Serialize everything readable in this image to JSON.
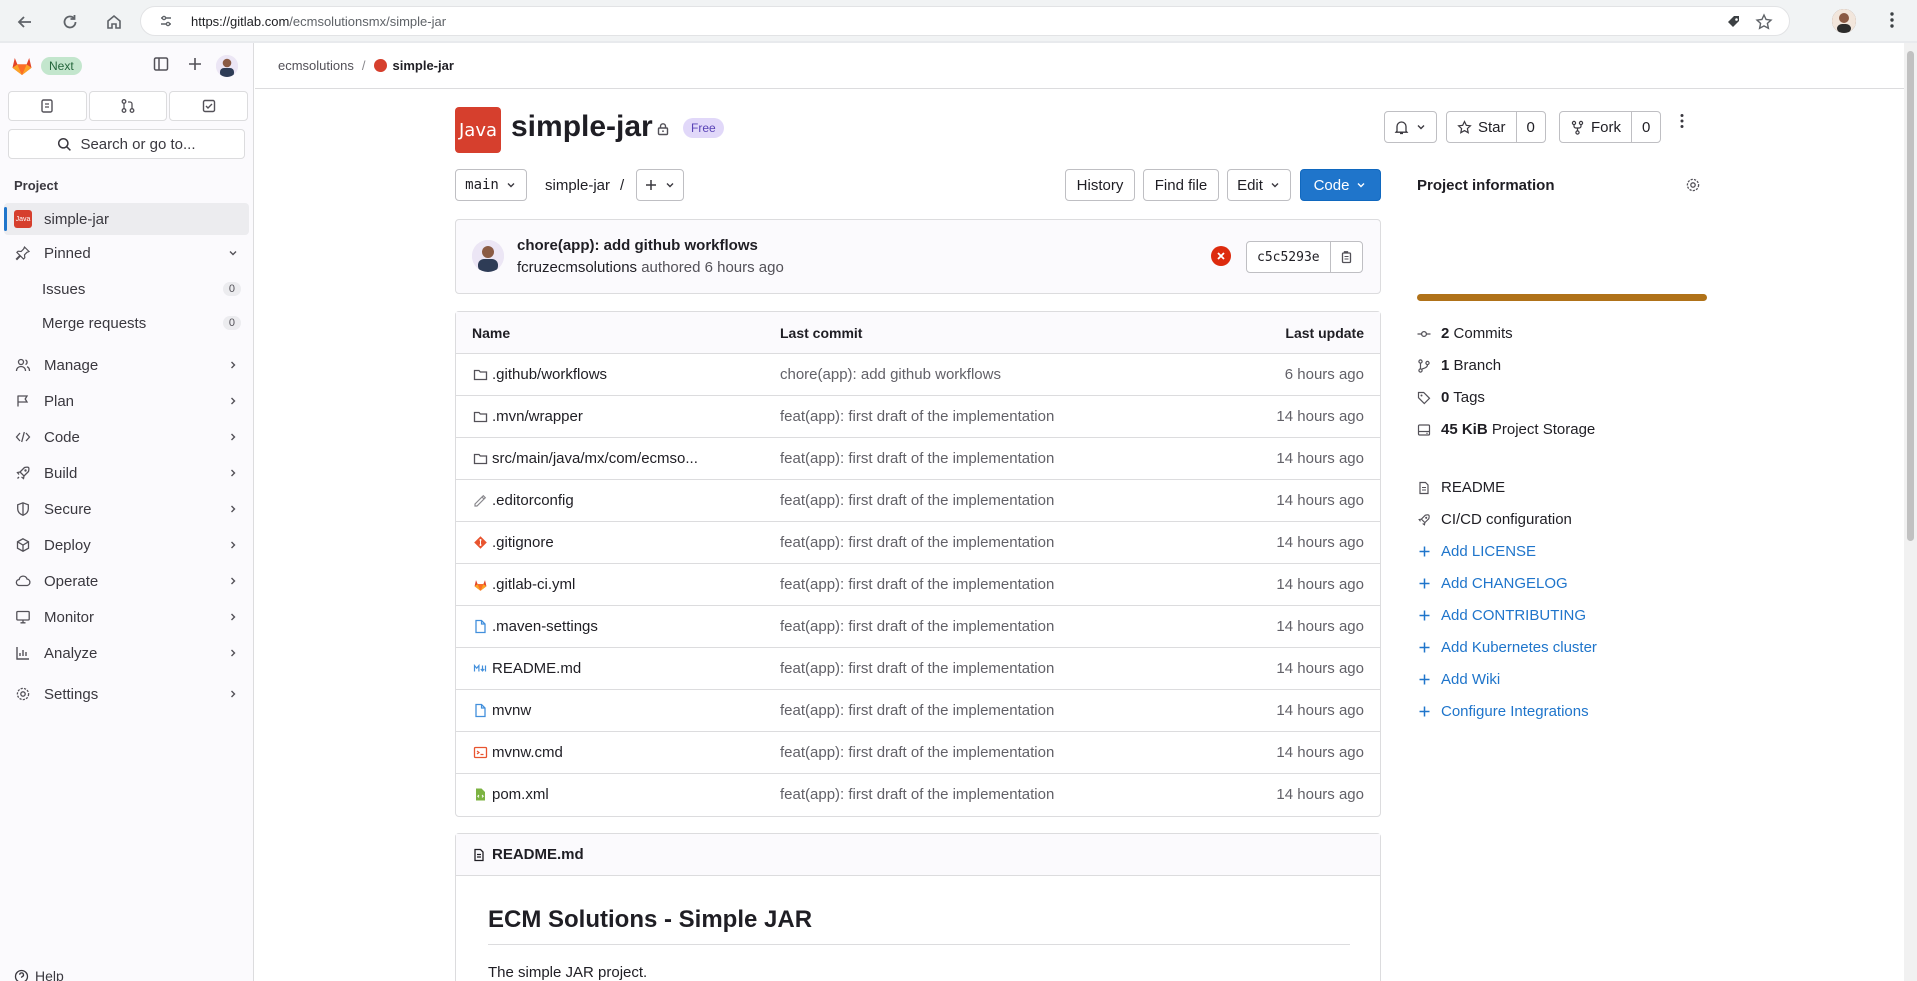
{
  "browser": {
    "url_host": "https://gitlab.com",
    "url_path": "/ecmsolutionsmx/simple-jar"
  },
  "sidebar": {
    "next_badge": "Next",
    "search_label": "Search or go to...",
    "section_label": "Project",
    "project_name": "simple-jar",
    "project_avatar_text": "Java",
    "pinned_label": "Pinned",
    "pinned_items": [
      {
        "label": "Issues",
        "count": "0"
      },
      {
        "label": "Merge requests",
        "count": "0"
      }
    ],
    "nav_items": [
      {
        "label": "Manage",
        "icon": "users-icon"
      },
      {
        "label": "Plan",
        "icon": "planning-icon"
      },
      {
        "label": "Code",
        "icon": "code-icon"
      },
      {
        "label": "Build",
        "icon": "rocket-icon"
      },
      {
        "label": "Secure",
        "icon": "shield-icon"
      },
      {
        "label": "Deploy",
        "icon": "deploy-icon"
      },
      {
        "label": "Operate",
        "icon": "cloud-icon"
      },
      {
        "label": "Monitor",
        "icon": "monitor-icon"
      },
      {
        "label": "Analyze",
        "icon": "chart-icon"
      },
      {
        "label": "Settings",
        "icon": "settings-icon"
      }
    ],
    "help_label": "Help"
  },
  "breadcrumb": {
    "group": "ecmsolutions",
    "project": "simple-jar"
  },
  "project": {
    "avatar_text": "Java",
    "title": "simple-jar",
    "tier_badge": "Free",
    "star_label": "Star",
    "star_count": "0",
    "fork_label": "Fork",
    "fork_count": "0"
  },
  "repo_toolbar": {
    "branch": "main",
    "path_root": "simple-jar",
    "path_sep": "/",
    "history_label": "History",
    "find_file_label": "Find file",
    "edit_label": "Edit",
    "code_label": "Code"
  },
  "last_commit": {
    "title": "chore(app): add github workflows",
    "author": "fcruzecmsolutions",
    "meta": "authored 6 hours ago",
    "sha": "c5c5293e"
  },
  "file_table": {
    "headers": {
      "name": "Name",
      "last_commit": "Last commit",
      "last_update": "Last update"
    },
    "rows": [
      {
        "name": ".github/workflows",
        "type": "folder",
        "commit": "chore(app): add github workflows",
        "updated": "6 hours ago"
      },
      {
        "name": ".mvn/wrapper",
        "type": "folder",
        "commit": "feat(app): first draft of the implementation",
        "updated": "14 hours ago"
      },
      {
        "name": "src/main/java/mx/com/ecmso...",
        "type": "folder",
        "commit": "feat(app): first draft of the implementation",
        "updated": "14 hours ago"
      },
      {
        "name": ".editorconfig",
        "type": "editorconfig",
        "commit": "feat(app): first draft of the implementation",
        "updated": "14 hours ago"
      },
      {
        "name": ".gitignore",
        "type": "git",
        "commit": "feat(app): first draft of the implementation",
        "updated": "14 hours ago"
      },
      {
        "name": ".gitlab-ci.yml",
        "type": "gitlab",
        "commit": "feat(app): first draft of the implementation",
        "updated": "14 hours ago"
      },
      {
        "name": ".maven-settings",
        "type": "file",
        "commit": "feat(app): first draft of the implementation",
        "updated": "14 hours ago"
      },
      {
        "name": "README.md",
        "type": "markdown",
        "commit": "feat(app): first draft of the implementation",
        "updated": "14 hours ago"
      },
      {
        "name": "mvnw",
        "type": "file",
        "commit": "feat(app): first draft of the implementation",
        "updated": "14 hours ago"
      },
      {
        "name": "mvnw.cmd",
        "type": "cmd",
        "commit": "feat(app): first draft of the implementation",
        "updated": "14 hours ago"
      },
      {
        "name": "pom.xml",
        "type": "xml",
        "commit": "feat(app): first draft of the implementation",
        "updated": "14 hours ago"
      }
    ]
  },
  "readme": {
    "filename": "README.md",
    "heading": "ECM Solutions - Simple JAR",
    "paragraph": "The simple JAR project."
  },
  "project_info": {
    "title": "Project information",
    "language_bar_color": "#b07219",
    "language_bar_fraction": 1.0,
    "stats": [
      {
        "value": "2",
        "label": "Commits",
        "icon": "commit-icon"
      },
      {
        "value": "1",
        "label": "Branch",
        "icon": "branch-icon"
      },
      {
        "value": "0",
        "label": "Tags",
        "icon": "tag-icon"
      },
      {
        "value": "45 KiB",
        "label": "Project Storage",
        "icon": "storage-icon"
      }
    ],
    "links": [
      {
        "label": "README",
        "icon": "doc-icon",
        "kind": "plain"
      },
      {
        "label": "CI/CD configuration",
        "icon": "rocket-icon",
        "kind": "plain"
      },
      {
        "label": "Add LICENSE",
        "icon": "plus-icon",
        "kind": "link"
      },
      {
        "label": "Add CHANGELOG",
        "icon": "plus-icon",
        "kind": "link"
      },
      {
        "label": "Add CONTRIBUTING",
        "icon": "plus-icon",
        "kind": "link"
      },
      {
        "label": "Add Kubernetes cluster",
        "icon": "plus-icon",
        "kind": "link"
      },
      {
        "label": "Add Wiki",
        "icon": "plus-icon",
        "kind": "link"
      },
      {
        "label": "Configure Integrations",
        "icon": "plus-icon",
        "kind": "link"
      }
    ]
  },
  "colors": {
    "accent": "#1f75cb",
    "danger": "#dd2b0e",
    "java": "#d63f2d"
  }
}
